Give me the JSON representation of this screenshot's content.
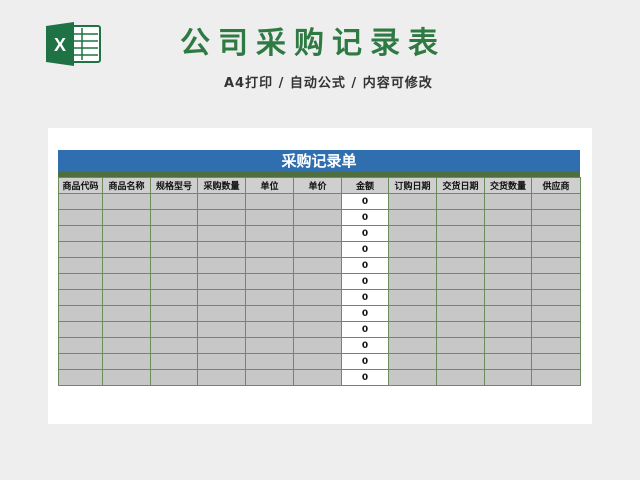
{
  "header": {
    "title": "公司采购记录表",
    "subtitle": "A4打印 / 自动公式 / 内容可修改",
    "logo_icon": "excel-icon",
    "logo_color": "#1f7244",
    "title_color": "#2f7a43"
  },
  "sheet": {
    "title": "采购记录单",
    "title_bar_color": "#2f6fb0",
    "columns": [
      "商品代码",
      "商品名称",
      "规格型号",
      "采购数量",
      "单位",
      "单价",
      "金额",
      "订购日期",
      "交货日期",
      "交货数量",
      "供应商"
    ],
    "rows": [
      [
        "",
        "",
        "",
        "",
        "",
        "",
        "0",
        "",
        "",
        "",
        ""
      ],
      [
        "",
        "",
        "",
        "",
        "",
        "",
        "0",
        "",
        "",
        "",
        ""
      ],
      [
        "",
        "",
        "",
        "",
        "",
        "",
        "0",
        "",
        "",
        "",
        ""
      ],
      [
        "",
        "",
        "",
        "",
        "",
        "",
        "0",
        "",
        "",
        "",
        ""
      ],
      [
        "",
        "",
        "",
        "",
        "",
        "",
        "0",
        "",
        "",
        "",
        ""
      ],
      [
        "",
        "",
        "",
        "",
        "",
        "",
        "0",
        "",
        "",
        "",
        ""
      ],
      [
        "",
        "",
        "",
        "",
        "",
        "",
        "0",
        "",
        "",
        "",
        ""
      ],
      [
        "",
        "",
        "",
        "",
        "",
        "",
        "0",
        "",
        "",
        "",
        ""
      ],
      [
        "",
        "",
        "",
        "",
        "",
        "",
        "0",
        "",
        "",
        "",
        ""
      ],
      [
        "",
        "",
        "",
        "",
        "",
        "",
        "0",
        "",
        "",
        "",
        ""
      ],
      [
        "",
        "",
        "",
        "",
        "",
        "",
        "0",
        "",
        "",
        "",
        ""
      ],
      [
        "",
        "",
        "",
        "",
        "",
        "",
        "0",
        "",
        "",
        "",
        ""
      ]
    ]
  }
}
